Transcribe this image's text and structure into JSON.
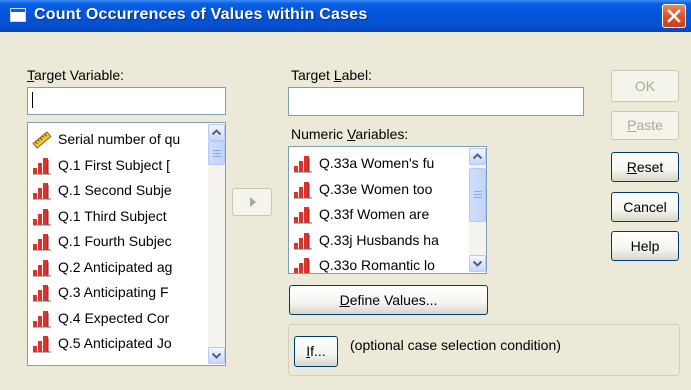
{
  "window": {
    "title": "Count Occurrences of Values within Cases"
  },
  "target_variable": {
    "label_prefix": "",
    "label_accel": "T",
    "label_rest": "arget Variable:",
    "value": ""
  },
  "target_label": {
    "label_prefix": "Target ",
    "label_accel": "L",
    "label_rest": "abel:",
    "value": ""
  },
  "source_list": {
    "items": [
      {
        "text": "Serial number of qu",
        "icon": "ruler-icon"
      },
      {
        "text": "Q.1  First Subject [",
        "icon": "bar-chart-icon"
      },
      {
        "text": "Q.1  Second Subje",
        "icon": "bar-chart-icon"
      },
      {
        "text": "Q.1  Third Subject",
        "icon": "bar-chart-icon"
      },
      {
        "text": "Q.1  Fourth Subjec",
        "icon": "bar-chart-icon"
      },
      {
        "text": "Q.2  Anticipated ag",
        "icon": "bar-chart-icon"
      },
      {
        "text": "Q.3  Anticipating F",
        "icon": "bar-chart-icon"
      },
      {
        "text": "Q.4  Expected Cor",
        "icon": "bar-chart-icon"
      },
      {
        "text": "Q.5  Anticipated Jo",
        "icon": "bar-chart-icon"
      }
    ]
  },
  "numeric_variables": {
    "label_prefix": "Numeric ",
    "label_accel": "V",
    "label_rest": "ariables:",
    "items": [
      {
        "text": "Q.33a Women's fu",
        "icon": "bar-chart-icon"
      },
      {
        "text": "Q.33e Women too",
        "icon": "bar-chart-icon"
      },
      {
        "text": "Q.33f Women are",
        "icon": "bar-chart-icon"
      },
      {
        "text": "Q.33j Husbands ha",
        "icon": "bar-chart-icon"
      },
      {
        "text": "Q.33o Romantic lo",
        "icon": "bar-chart-icon"
      }
    ]
  },
  "buttons": {
    "ok": "OK",
    "paste_accel": "P",
    "paste_rest": "aste",
    "reset_accel": "R",
    "reset_rest": "eset",
    "cancel": "Cancel",
    "help": "Help",
    "define_prefix": "",
    "define_accel": "D",
    "define_rest": "efine Values...",
    "if_accel": "I",
    "if_rest": "f..."
  },
  "if_caption": "(optional case selection condition)",
  "colors": {
    "title_bar": "#0454D8",
    "dialog_bg": "#ECE9D8",
    "close_button": "#D9542B"
  }
}
